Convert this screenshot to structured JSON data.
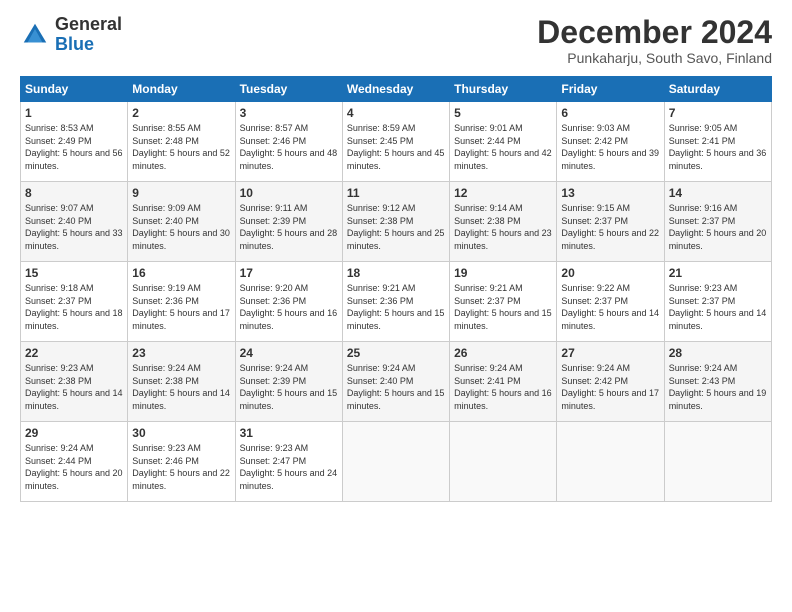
{
  "header": {
    "logo_general": "General",
    "logo_blue": "Blue",
    "month_title": "December 2024",
    "location": "Punkaharju, South Savo, Finland"
  },
  "days_of_week": [
    "Sunday",
    "Monday",
    "Tuesday",
    "Wednesday",
    "Thursday",
    "Friday",
    "Saturday"
  ],
  "weeks": [
    [
      {
        "day": 1,
        "sunrise": "8:53 AM",
        "sunset": "2:49 PM",
        "daylight": "5 hours and 56 minutes."
      },
      {
        "day": 2,
        "sunrise": "8:55 AM",
        "sunset": "2:48 PM",
        "daylight": "5 hours and 52 minutes."
      },
      {
        "day": 3,
        "sunrise": "8:57 AM",
        "sunset": "2:46 PM",
        "daylight": "5 hours and 48 minutes."
      },
      {
        "day": 4,
        "sunrise": "8:59 AM",
        "sunset": "2:45 PM",
        "daylight": "5 hours and 45 minutes."
      },
      {
        "day": 5,
        "sunrise": "9:01 AM",
        "sunset": "2:44 PM",
        "daylight": "5 hours and 42 minutes."
      },
      {
        "day": 6,
        "sunrise": "9:03 AM",
        "sunset": "2:42 PM",
        "daylight": "5 hours and 39 minutes."
      },
      {
        "day": 7,
        "sunrise": "9:05 AM",
        "sunset": "2:41 PM",
        "daylight": "5 hours and 36 minutes."
      }
    ],
    [
      {
        "day": 8,
        "sunrise": "9:07 AM",
        "sunset": "2:40 PM",
        "daylight": "5 hours and 33 minutes."
      },
      {
        "day": 9,
        "sunrise": "9:09 AM",
        "sunset": "2:40 PM",
        "daylight": "5 hours and 30 minutes."
      },
      {
        "day": 10,
        "sunrise": "9:11 AM",
        "sunset": "2:39 PM",
        "daylight": "5 hours and 28 minutes."
      },
      {
        "day": 11,
        "sunrise": "9:12 AM",
        "sunset": "2:38 PM",
        "daylight": "5 hours and 25 minutes."
      },
      {
        "day": 12,
        "sunrise": "9:14 AM",
        "sunset": "2:38 PM",
        "daylight": "5 hours and 23 minutes."
      },
      {
        "day": 13,
        "sunrise": "9:15 AM",
        "sunset": "2:37 PM",
        "daylight": "5 hours and 22 minutes."
      },
      {
        "day": 14,
        "sunrise": "9:16 AM",
        "sunset": "2:37 PM",
        "daylight": "5 hours and 20 minutes."
      }
    ],
    [
      {
        "day": 15,
        "sunrise": "9:18 AM",
        "sunset": "2:37 PM",
        "daylight": "5 hours and 18 minutes."
      },
      {
        "day": 16,
        "sunrise": "9:19 AM",
        "sunset": "2:36 PM",
        "daylight": "5 hours and 17 minutes."
      },
      {
        "day": 17,
        "sunrise": "9:20 AM",
        "sunset": "2:36 PM",
        "daylight": "5 hours and 16 minutes."
      },
      {
        "day": 18,
        "sunrise": "9:21 AM",
        "sunset": "2:36 PM",
        "daylight": "5 hours and 15 minutes."
      },
      {
        "day": 19,
        "sunrise": "9:21 AM",
        "sunset": "2:37 PM",
        "daylight": "5 hours and 15 minutes."
      },
      {
        "day": 20,
        "sunrise": "9:22 AM",
        "sunset": "2:37 PM",
        "daylight": "5 hours and 14 minutes."
      },
      {
        "day": 21,
        "sunrise": "9:23 AM",
        "sunset": "2:37 PM",
        "daylight": "5 hours and 14 minutes."
      }
    ],
    [
      {
        "day": 22,
        "sunrise": "9:23 AM",
        "sunset": "2:38 PM",
        "daylight": "5 hours and 14 minutes."
      },
      {
        "day": 23,
        "sunrise": "9:24 AM",
        "sunset": "2:38 PM",
        "daylight": "5 hours and 14 minutes."
      },
      {
        "day": 24,
        "sunrise": "9:24 AM",
        "sunset": "2:39 PM",
        "daylight": "5 hours and 15 minutes."
      },
      {
        "day": 25,
        "sunrise": "9:24 AM",
        "sunset": "2:40 PM",
        "daylight": "5 hours and 15 minutes."
      },
      {
        "day": 26,
        "sunrise": "9:24 AM",
        "sunset": "2:41 PM",
        "daylight": "5 hours and 16 minutes."
      },
      {
        "day": 27,
        "sunrise": "9:24 AM",
        "sunset": "2:42 PM",
        "daylight": "5 hours and 17 minutes."
      },
      {
        "day": 28,
        "sunrise": "9:24 AM",
        "sunset": "2:43 PM",
        "daylight": "5 hours and 19 minutes."
      }
    ],
    [
      {
        "day": 29,
        "sunrise": "9:24 AM",
        "sunset": "2:44 PM",
        "daylight": "5 hours and 20 minutes."
      },
      {
        "day": 30,
        "sunrise": "9:23 AM",
        "sunset": "2:46 PM",
        "daylight": "5 hours and 22 minutes."
      },
      {
        "day": 31,
        "sunrise": "9:23 AM",
        "sunset": "2:47 PM",
        "daylight": "5 hours and 24 minutes."
      },
      null,
      null,
      null,
      null
    ]
  ]
}
